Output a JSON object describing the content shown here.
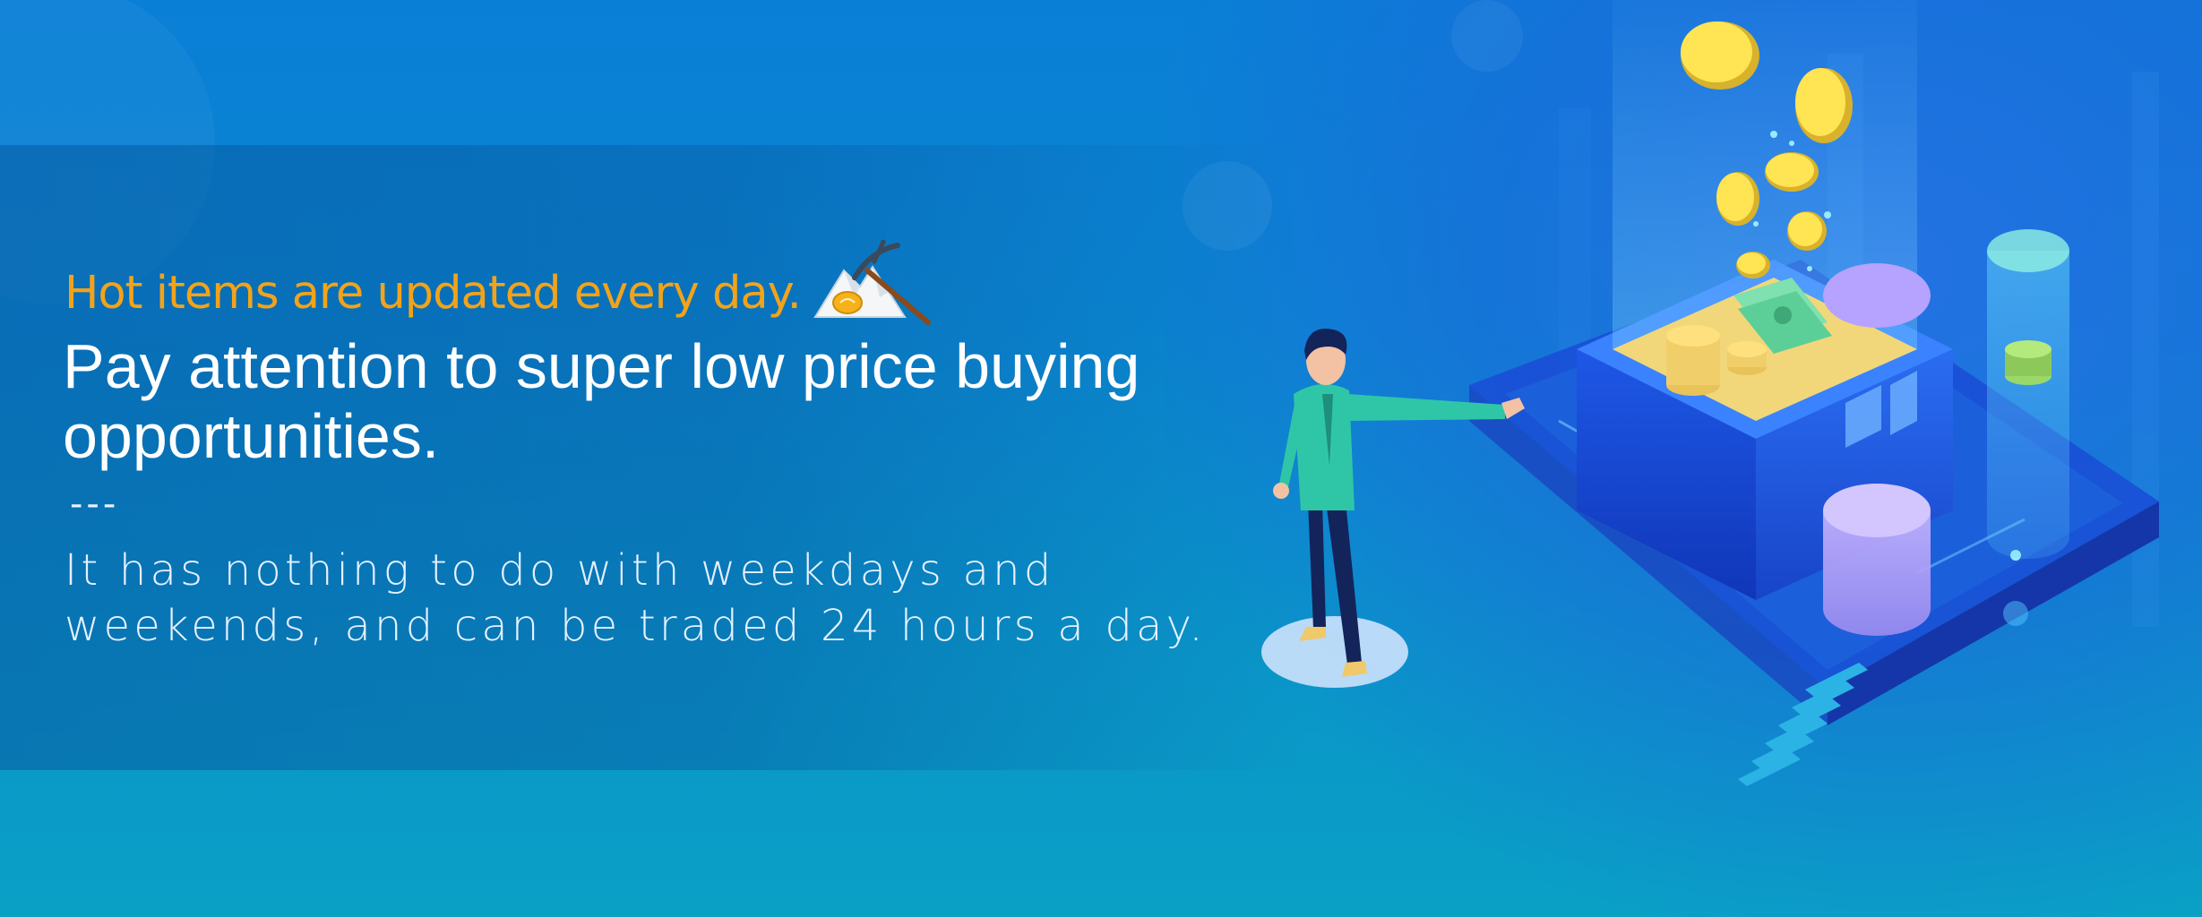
{
  "banner": {
    "tagline": "Hot items are updated every day.",
    "headline": "Pay attention to super low price buying opportunities.",
    "separator": "---",
    "subtext": "It has nothing to do with weekdays and weekends, and can be traded 24 hours a day."
  },
  "icons": {
    "tagline_icon": "mining-pickaxe-icon"
  },
  "colors": {
    "tagline": "#f2a31a",
    "headline": "#ffffff",
    "background": "#0a86d2"
  }
}
